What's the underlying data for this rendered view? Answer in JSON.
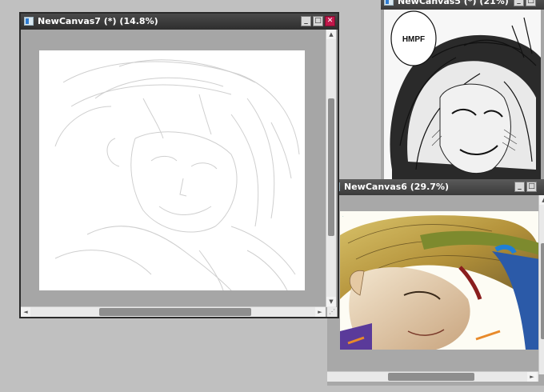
{
  "windows": {
    "canvas7": {
      "title": "NewCanvas7 (*) (14.8%)"
    },
    "canvas5": {
      "title": "NewCanvas5 (*) (21%)",
      "speech_text": "HMPF"
    },
    "canvas6": {
      "title": "NewCanvas6 (29.7%)"
    }
  },
  "icons": {
    "minimize": "minimize-icon",
    "maximize": "maximize-icon",
    "close": "close-icon",
    "arrow_up": "arrow-up-icon",
    "arrow_down": "arrow-down-icon",
    "arrow_left": "arrow-left-icon",
    "arrow_right": "arrow-right-icon"
  },
  "colors": {
    "workspace": "#c0c0c0",
    "title_bar": "#2e2e2e",
    "close_button": "#c0174a",
    "canvas_background": "#a6a6a6"
  }
}
